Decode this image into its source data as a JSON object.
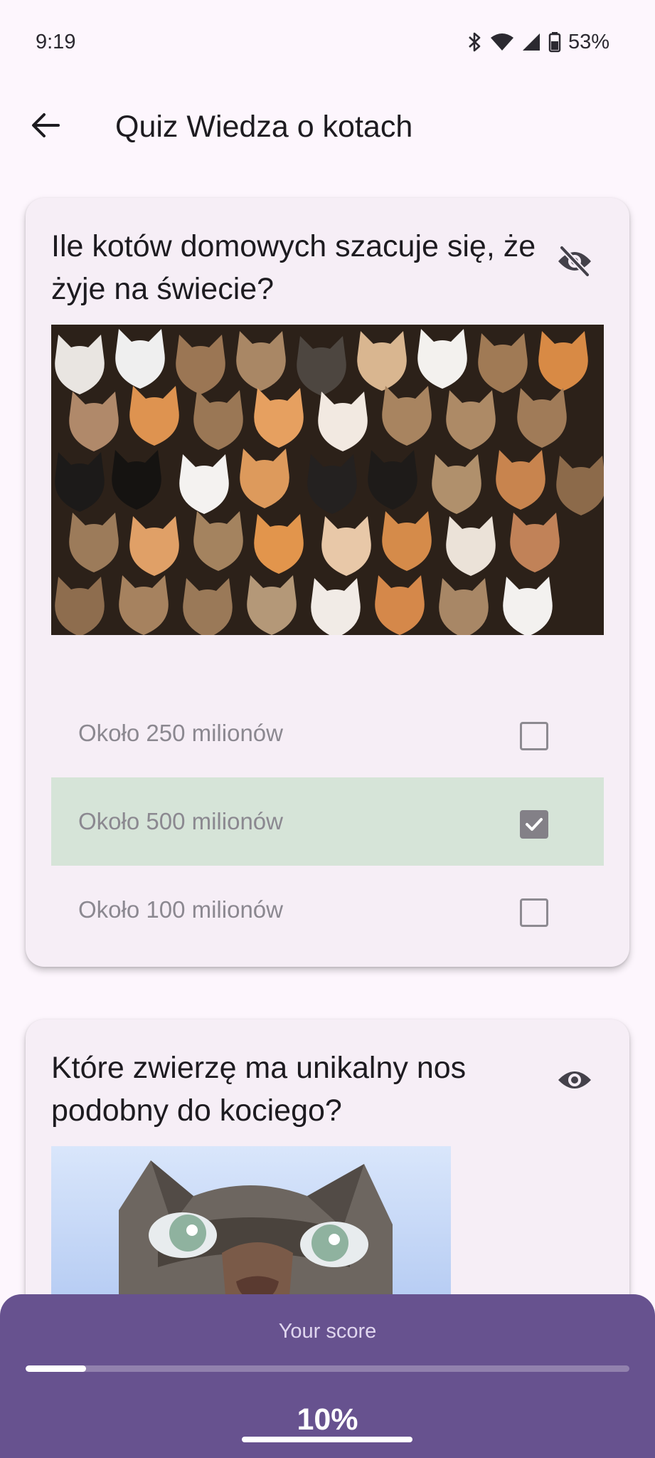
{
  "status_bar": {
    "time": "9:19",
    "battery": "53%"
  },
  "app_bar": {
    "title": "Quiz Wiedza o kotach",
    "back_icon": "arrow-back-icon"
  },
  "questions": [
    {
      "text": "Ile kotów domowych szacuje się, że żyje na świecie?",
      "visibility_icon": "eye-off-icon",
      "options": [
        {
          "label": "Około 250 milionów",
          "checked": false
        },
        {
          "label": "Około 500 milionów",
          "checked": true
        },
        {
          "label": "Około 100 milionów",
          "checked": false
        }
      ]
    },
    {
      "text": "Które zwierzę ma unikalny nos podobny do kociego?",
      "visibility_icon": "eye-icon"
    }
  ],
  "score": {
    "label": "Your score",
    "value": "10%",
    "progress": 0.1
  },
  "colors": {
    "background": "#fdf6fd",
    "card": "#f6eef6",
    "selected_option": "#d6e4d8",
    "score_sheet": "#67528f",
    "progress_track": "#9181ad"
  }
}
